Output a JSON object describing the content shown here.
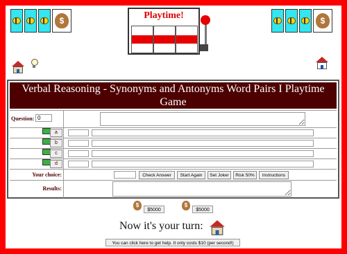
{
  "machine": {
    "title": "Playtime!"
  },
  "strips": {
    "left_bag_symbol": "$",
    "right_bag_symbol": "$"
  },
  "game": {
    "title": "Verbal Reasoning - Synonyms and Antonyms Word Pairs I Playtime Game",
    "question_label": "Question:",
    "question_number": "0",
    "options": [
      {
        "letter": "a"
      },
      {
        "letter": "b"
      },
      {
        "letter": "c"
      },
      {
        "letter": "d"
      }
    ],
    "your_choice_label": "Your choice:",
    "buttons": {
      "check": "Check Answer",
      "start": "Start Again",
      "joker": "Set Joker",
      "risk": "Risk 50%",
      "instructions": "Instructions"
    },
    "results_label": "Results:"
  },
  "bank": {
    "amount1": "$5000",
    "amount2": "$5000",
    "bag_symbol": "$"
  },
  "turn_text": "Now it's your turn:",
  "help_button": "You can click here to get help. It only costs $10 (per second!)",
  "colors": {
    "frame": "#ff0000",
    "title_bg": "#4d0000",
    "reel": "#33e6f0",
    "machine_title": "#e00000"
  }
}
